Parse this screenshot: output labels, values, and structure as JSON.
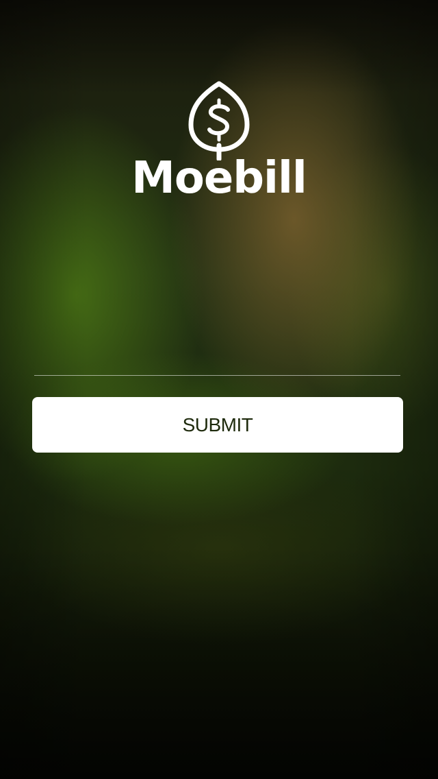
{
  "app": {
    "name": "Moebill",
    "logo_icon": "leaf-dollar-icon"
  },
  "form": {
    "input_value": "",
    "input_placeholder": "",
    "submit_label": "SUBMIT"
  },
  "colors": {
    "button_bg": "#ffffff",
    "button_text": "#1e2a0c",
    "logo": "#ffffff"
  }
}
